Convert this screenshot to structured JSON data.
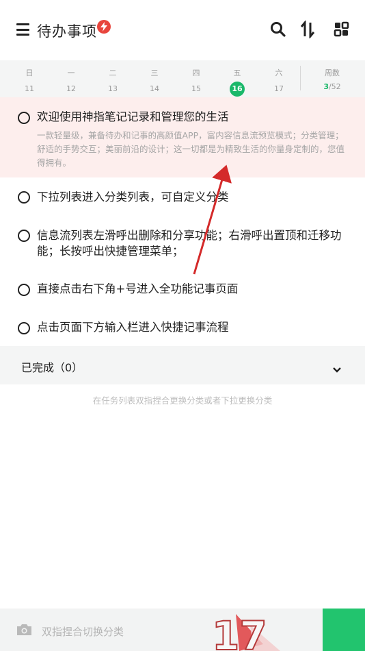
{
  "header": {
    "title": "待办事项",
    "icons": [
      "menu-icon",
      "flash-badge-icon",
      "search-icon",
      "sort-icon",
      "grid-view-icon"
    ]
  },
  "week": {
    "days": [
      {
        "weekday": "日",
        "date": "11"
      },
      {
        "weekday": "一",
        "date": "12"
      },
      {
        "weekday": "二",
        "date": "13"
      },
      {
        "weekday": "三",
        "date": "14"
      },
      {
        "weekday": "四",
        "date": "15"
      },
      {
        "weekday": "五",
        "date": "16",
        "today": true
      },
      {
        "weekday": "六",
        "date": "17"
      }
    ],
    "weeknum_label": "周数",
    "weeknum_current": "3",
    "weeknum_total": "/52",
    "today_color": "#1ab86a"
  },
  "tasks": [
    {
      "title": "欢迎使用神指笔记记录和管理您的生活",
      "desc": "一款轻量级，兼备待办和记事的高颜值APP，富内容信息流预览模式；分类管理；舒适的手势交互；美丽前沿的设计；这一切都是为精致生活的你量身定制的，您值得拥有。",
      "highlighted": true
    },
    {
      "title": "下拉列表进入分类列表，可自定义分类"
    },
    {
      "title": "信息流列表左滑呼出删除和分享功能；右滑呼出置顶和迁移功能；长按呼出快捷管理菜单；"
    },
    {
      "title": "直接点击右下角+号进入全功能记事页面"
    },
    {
      "title": "点击页面下方输入栏进入快捷记事流程"
    }
  ],
  "completed": {
    "label": "已完成（0）"
  },
  "hint": "在任务列表双指捏合更换分类或者下拉更换分类",
  "bottom": {
    "placeholder": "双指捏合切换分类",
    "fab_color": "#22c46e"
  },
  "watermark": {
    "text": "17"
  },
  "colors": {
    "highlight_bg": "#fdeeed",
    "badge": "#e8453c",
    "arrow": "#d42a2a"
  }
}
